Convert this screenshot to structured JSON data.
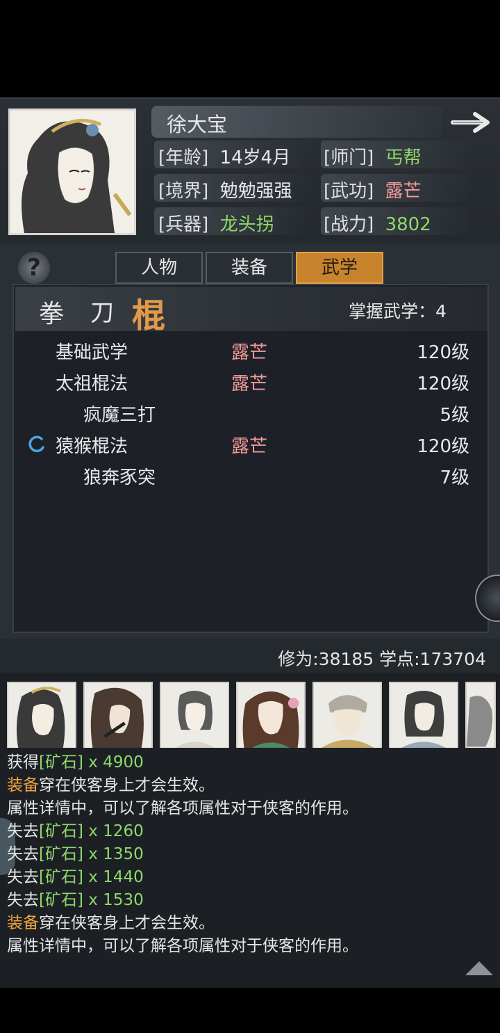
{
  "character": {
    "name": "徐大宝",
    "stats": [
      {
        "label": "[年龄]",
        "value": "14岁4月",
        "color": "white"
      },
      {
        "label": "[师门]",
        "value": "丐帮",
        "color": "green"
      },
      {
        "label": "[境界]",
        "value": "勉勉强强",
        "color": "white"
      },
      {
        "label": "[武功]",
        "value": "露芒",
        "color": "pink"
      },
      {
        "label": "[兵器]",
        "value": "龙头拐",
        "color": "green"
      },
      {
        "label": "[战力]",
        "value": "3802",
        "color": "green"
      }
    ]
  },
  "tabs": [
    {
      "label": "人物",
      "active": false
    },
    {
      "label": "装备",
      "active": false
    },
    {
      "label": "武学",
      "active": true
    }
  ],
  "categories": [
    {
      "label": "拳",
      "active": false
    },
    {
      "label": "刀",
      "active": false
    },
    {
      "label": "棍",
      "active": true
    }
  ],
  "mastered_label": "掌握武学：4",
  "skills": [
    {
      "name": "基础武学",
      "tag": "露芒",
      "level": "120级",
      "indent": false
    },
    {
      "name": "太祖棍法",
      "tag": "露芒",
      "level": "120级",
      "indent": false
    },
    {
      "name": "疯魔三打",
      "tag": "",
      "level": "5级",
      "indent": true
    },
    {
      "name": "猿猴棍法",
      "tag": "露芒",
      "level": "120级",
      "indent": false
    },
    {
      "name": "狼奔豕突",
      "tag": "",
      "level": "7级",
      "indent": true
    }
  ],
  "cultivation": "修为:38185  学点:173704",
  "log": [
    [
      {
        "t": "获得",
        "c": ""
      },
      {
        "t": "[矿石]",
        "c": "g"
      },
      {
        "t": " x 4900",
        "c": "g"
      }
    ],
    [
      {
        "t": "装备",
        "c": "o"
      },
      {
        "t": "穿在侠客身上才会生效。",
        "c": ""
      }
    ],
    [
      {
        "t": "属性详情中，可以了解各项属性对于侠客的作用。",
        "c": ""
      }
    ],
    [
      {
        "t": "失去",
        "c": ""
      },
      {
        "t": "[矿石]",
        "c": "g"
      },
      {
        "t": " x 1260",
        "c": "g"
      }
    ],
    [
      {
        "t": "失去",
        "c": ""
      },
      {
        "t": "[矿石]",
        "c": "g"
      },
      {
        "t": " x 1350",
        "c": "g"
      }
    ],
    [
      {
        "t": "失去",
        "c": ""
      },
      {
        "t": "[矿石]",
        "c": "g"
      },
      {
        "t": " x 1440",
        "c": "g"
      }
    ],
    [
      {
        "t": "失去",
        "c": ""
      },
      {
        "t": "[矿石]",
        "c": "g"
      },
      {
        "t": " x 1530",
        "c": "g"
      }
    ],
    [
      {
        "t": "装备",
        "c": "o"
      },
      {
        "t": "穿在侠客身上才会生效。",
        "c": ""
      }
    ],
    [
      {
        "t": "属性详情中，可以了解各项属性对于侠客的作用。",
        "c": ""
      }
    ]
  ],
  "icons": {
    "next": "arrow-right-icon",
    "help": "question-icon",
    "loading": "loading-spinner-icon",
    "scroll_up": "triangle-up-icon"
  }
}
